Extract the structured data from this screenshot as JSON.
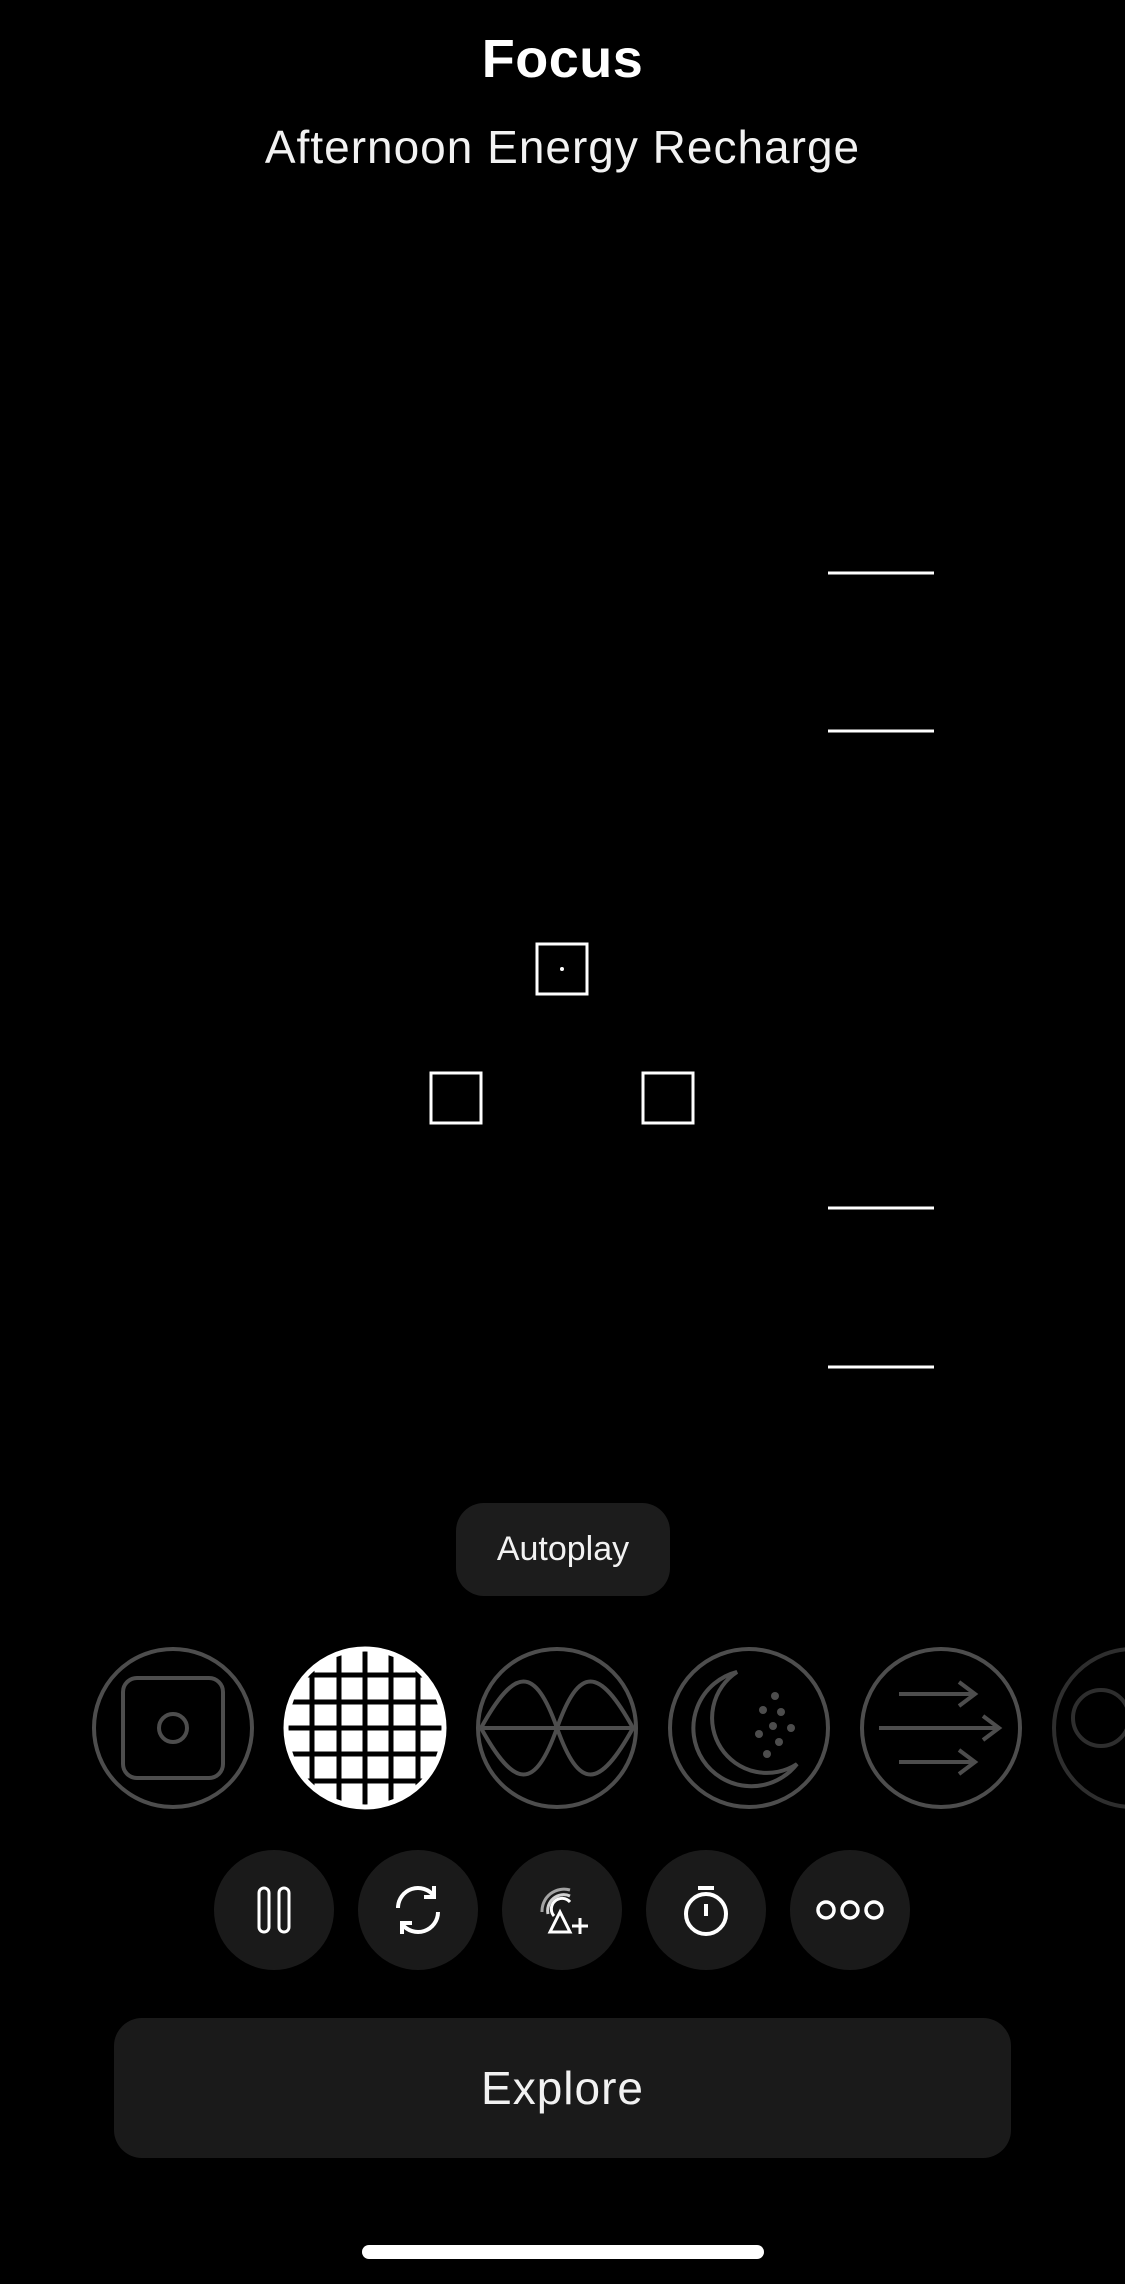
{
  "header": {
    "title": "Focus",
    "subtitle": "Afternoon Energy Recharge"
  },
  "autoplay": {
    "label": "Autoplay"
  },
  "modes": [
    {
      "icon": "square-circle-icon",
      "selected": false
    },
    {
      "icon": "grid-sphere-icon",
      "selected": true
    },
    {
      "icon": "wave-sphere-icon",
      "selected": false
    },
    {
      "icon": "moon-dots-icon",
      "selected": false
    },
    {
      "icon": "arrows-right-icon",
      "selected": false
    },
    {
      "icon": "partial-icon",
      "selected": false
    }
  ],
  "controls": [
    {
      "icon": "pause-icon"
    },
    {
      "icon": "refresh-icon"
    },
    {
      "icon": "broadcast-add-icon"
    },
    {
      "icon": "timer-icon"
    },
    {
      "icon": "more-icon"
    }
  ],
  "explore": {
    "label": "Explore"
  },
  "colors": {
    "background": "#000000",
    "grid": "#4a4a4a",
    "button": "#1a1a1a",
    "foreground": "#ffffff"
  }
}
